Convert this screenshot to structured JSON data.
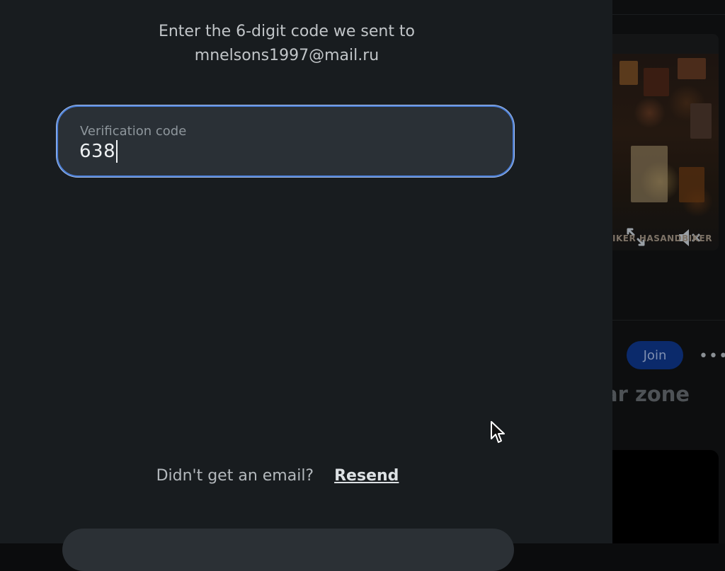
{
  "modal": {
    "instruction_line1": "Enter the 6-digit code we sent to",
    "instruction_line2": "mnelsons1997@mail.ru",
    "code_field": {
      "label": "Verification code",
      "value": "638"
    },
    "resend_prompt": "Didn't get an email?",
    "resend_link": "Resend"
  },
  "background_feed": {
    "video_watermark": "IKER  HASANDBIKER",
    "join_label": "Join",
    "post_title_fragment": "ar zone",
    "icons": [
      "expand-icon",
      "mute-icon",
      "more-icon"
    ]
  },
  "colors": {
    "modal_bg": "#181c1f",
    "field_bg": "#2a3036",
    "focus_border": "#4c7fd6",
    "join_bg": "#0b2a6b"
  }
}
